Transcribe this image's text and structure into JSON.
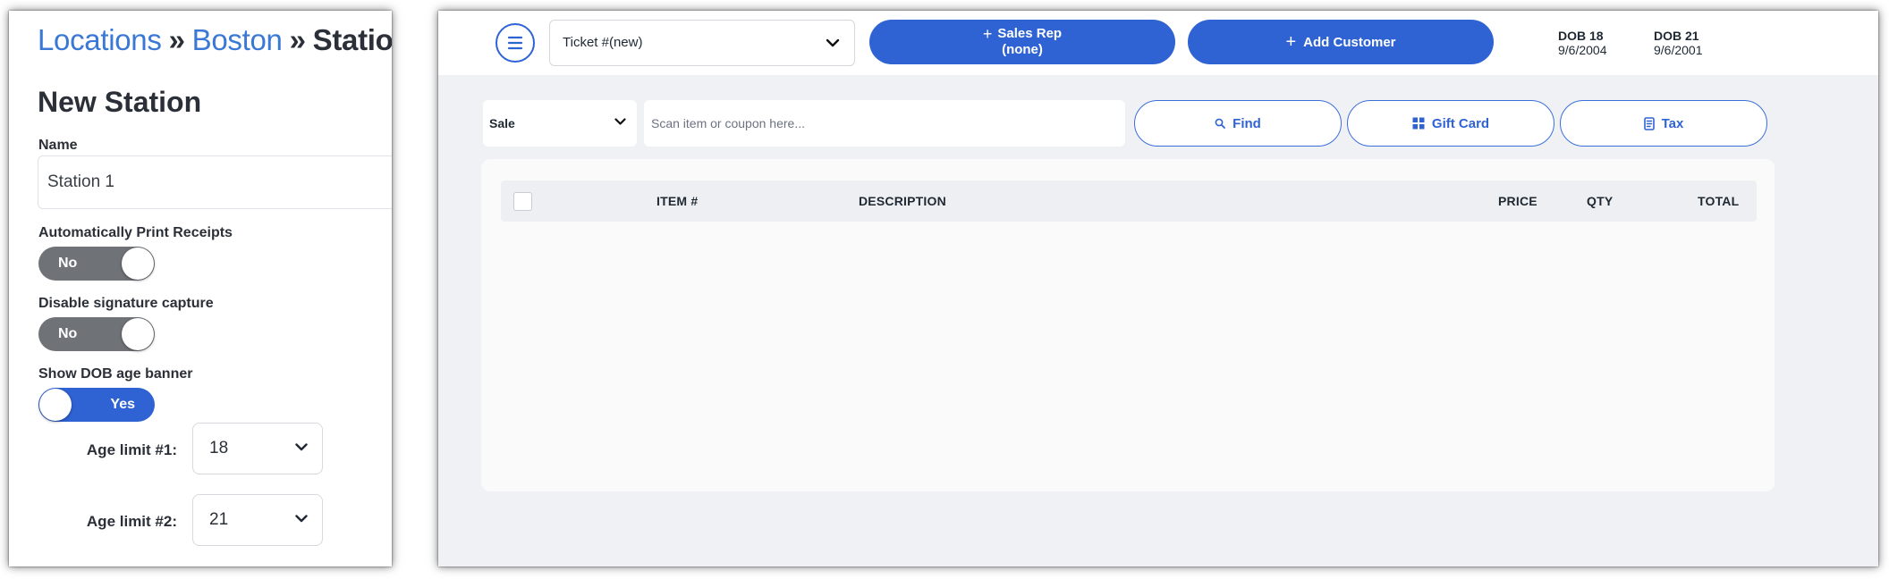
{
  "station_form": {
    "breadcrumb": {
      "locations": "Locations",
      "separator": "»",
      "city": "Boston",
      "current": "Stations"
    },
    "title": "New Station",
    "name_label": "Name",
    "name_value": "Station 1",
    "auto_print_label": "Automatically Print Receipts",
    "auto_print_state": "No",
    "disable_sig_label": "Disable signature capture",
    "disable_sig_state": "No",
    "dob_banner_label": "Show DOB age banner",
    "dob_banner_state": "Yes",
    "age_limit_1_label": "Age limit #1:",
    "age_limit_1_value": "18",
    "age_limit_2_label": "Age limit #2:",
    "age_limit_2_value": "21"
  },
  "pos": {
    "ticket_select": "Ticket #(new)",
    "sales_rep_label": "Sales Rep",
    "sales_rep_value": "(none)",
    "add_customer_label": "Add Customer",
    "dob_banners": [
      {
        "label": "DOB 18",
        "date": "9/6/2004"
      },
      {
        "label": "DOB 21",
        "date": "9/6/2001"
      }
    ],
    "sale_type": "Sale",
    "scan_placeholder": "Scan item or coupon here...",
    "find_label": "Find",
    "gift_card_label": "Gift Card",
    "tax_label": "Tax",
    "table_headers": {
      "item": "ITEM #",
      "description": "DESCRIPTION",
      "price": "PRICE",
      "qty": "QTY",
      "total": "TOTAL"
    }
  },
  "colors": {
    "brand_blue": "#2f63d4",
    "link_blue": "#3a78d6",
    "toggle_off": "#6f7378",
    "panel_bg": "#f0f1f5"
  }
}
